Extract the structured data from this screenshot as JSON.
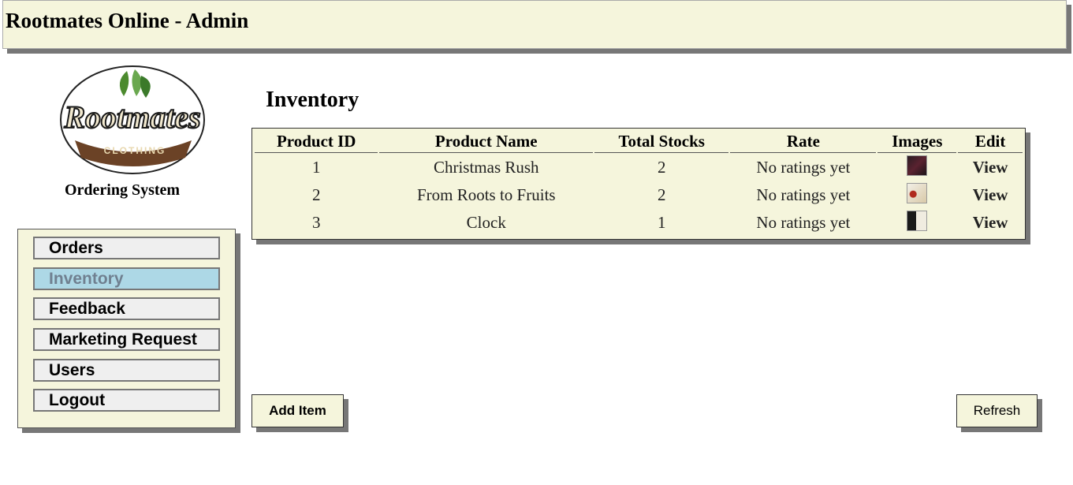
{
  "header": {
    "title": "Rootmates Online - Admin"
  },
  "logo": {
    "text_main": "Rootmates",
    "text_sub": "CLOTHING"
  },
  "subtitle": "Ordering System",
  "nav": {
    "items": [
      {
        "label": "Orders"
      },
      {
        "label": "Inventory"
      },
      {
        "label": "Feedback"
      },
      {
        "label": "Marketing Request"
      },
      {
        "label": "Users"
      },
      {
        "label": "Logout"
      }
    ],
    "active": "Inventory"
  },
  "page_title": "Inventory",
  "table": {
    "headers": [
      "Product ID",
      "Product Name",
      "Total Stocks",
      "Rate",
      "Images",
      "Edit"
    ],
    "rows": [
      {
        "id": "1",
        "name": "Christmas Rush",
        "stocks": "2",
        "rate": "No ratings yet",
        "image": "shirt-thumbnail-dark",
        "edit": "View"
      },
      {
        "id": "2",
        "name": "From Roots to Fruits",
        "stocks": "2",
        "rate": "No ratings yet",
        "image": "shirt-thumbnail-white",
        "edit": "View"
      },
      {
        "id": "3",
        "name": "Clock",
        "stocks": "1",
        "rate": "No ratings yet",
        "image": "shirt-thumbnail-black-white",
        "edit": "View"
      }
    ]
  },
  "buttons": {
    "add_item": "Add Item",
    "refresh": "Refresh"
  },
  "colors": {
    "panel": "#f5f5dc",
    "active_nav": "#add8e6",
    "shadow": "#777777"
  }
}
